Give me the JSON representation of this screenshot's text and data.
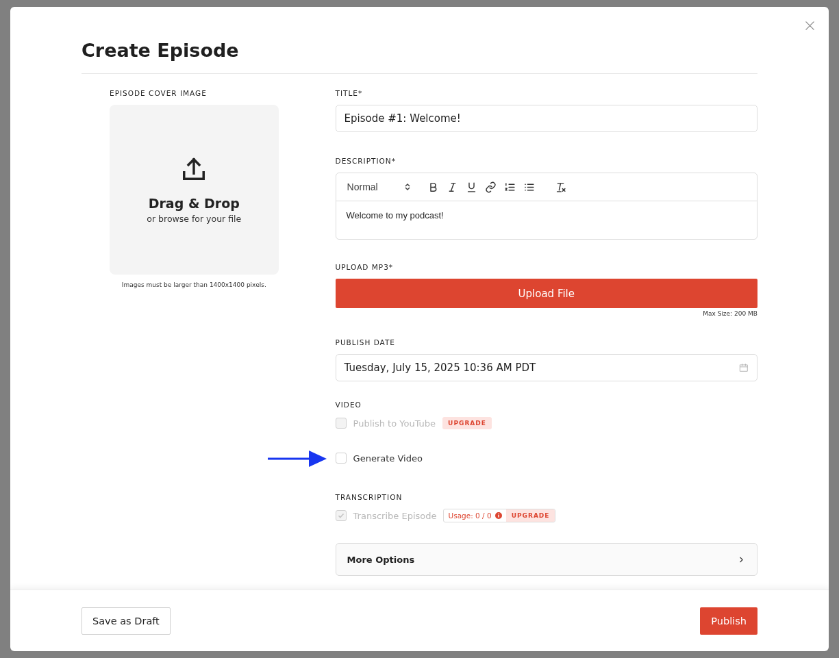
{
  "dialog": {
    "title": "Create Episode"
  },
  "cover": {
    "label": "EPISODE COVER IMAGE",
    "heading": "Drag & Drop",
    "subtext": "or browse for your file",
    "note": "Images must be larger than 1400x1400 pixels."
  },
  "title_field": {
    "label": "TITLE*",
    "value": "Episode #1: Welcome!"
  },
  "description": {
    "label": "DESCRIPTION*",
    "format": "Normal",
    "value": "Welcome to my podcast!"
  },
  "upload": {
    "label": "UPLOAD MP3*",
    "button": "Upload File",
    "note": "Max Size: 200 MB"
  },
  "publish_date": {
    "label": "PUBLISH DATE",
    "value": "Tuesday, July 15, 2025 10:36 AM PDT"
  },
  "video": {
    "label": "VIDEO",
    "options": [
      {
        "label": "Publish to YouTube",
        "checked": false,
        "disabled": true,
        "badge": "UPGRADE",
        "highlighted": false
      },
      {
        "label": "Generate Video",
        "checked": false,
        "disabled": false,
        "highlighted": true
      }
    ]
  },
  "transcription": {
    "label": "TRANSCRIPTION",
    "option": {
      "label": "Transcribe Episode",
      "checked": true,
      "disabled": true,
      "usage": "Usage: 0 / 0",
      "badge": "UPGRADE"
    }
  },
  "more_options": {
    "label": "More Options",
    "expanded": false
  },
  "footer": {
    "draft_button": "Save as Draft",
    "publish_button": "Publish"
  }
}
